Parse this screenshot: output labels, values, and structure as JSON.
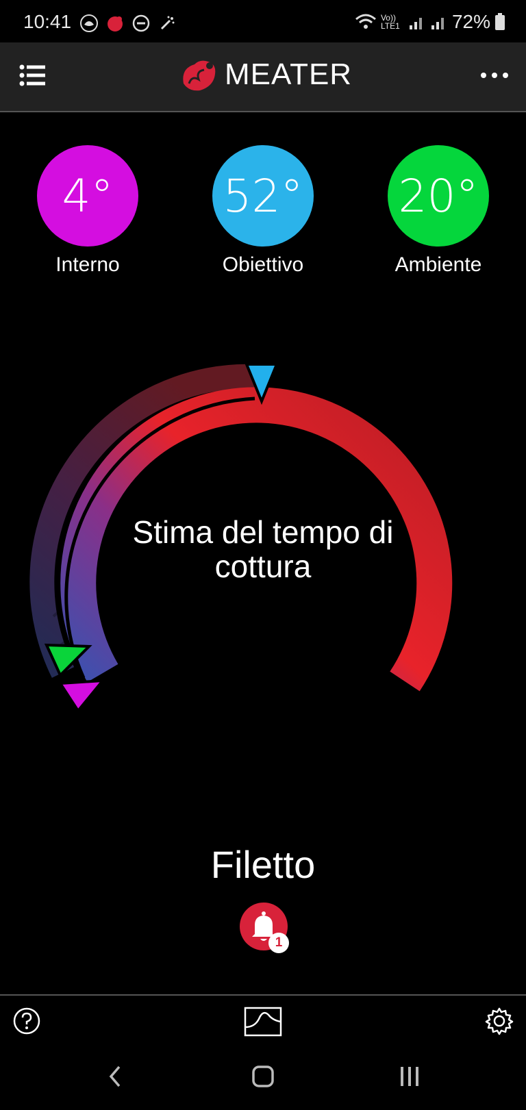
{
  "status": {
    "time": "10:41",
    "network": "Vo)) LTE1",
    "battery": "72%"
  },
  "header": {
    "brand": "MEATER"
  },
  "temperatures": [
    {
      "value": "4°",
      "label": "Interno",
      "color": "#d40ee0"
    },
    {
      "value": "52°",
      "label": "Obiettivo",
      "color": "#2bb3ea"
    },
    {
      "value": "20°",
      "label": "Ambiente",
      "color": "#05d63c"
    }
  ],
  "gauge": {
    "text": "Stima del tempo di cottura",
    "colors": {
      "start": "#3a52b0",
      "mid": "#8a2f88",
      "end": "#e8232a"
    }
  },
  "cook": {
    "name": "Filetto",
    "alarm_count": "1",
    "alarm_color": "#d8223a"
  },
  "icons": {
    "menu": "list-icon",
    "more": "more-dots-icon",
    "help": "help-icon",
    "graph": "graph-icon",
    "settings": "gear-icon"
  }
}
